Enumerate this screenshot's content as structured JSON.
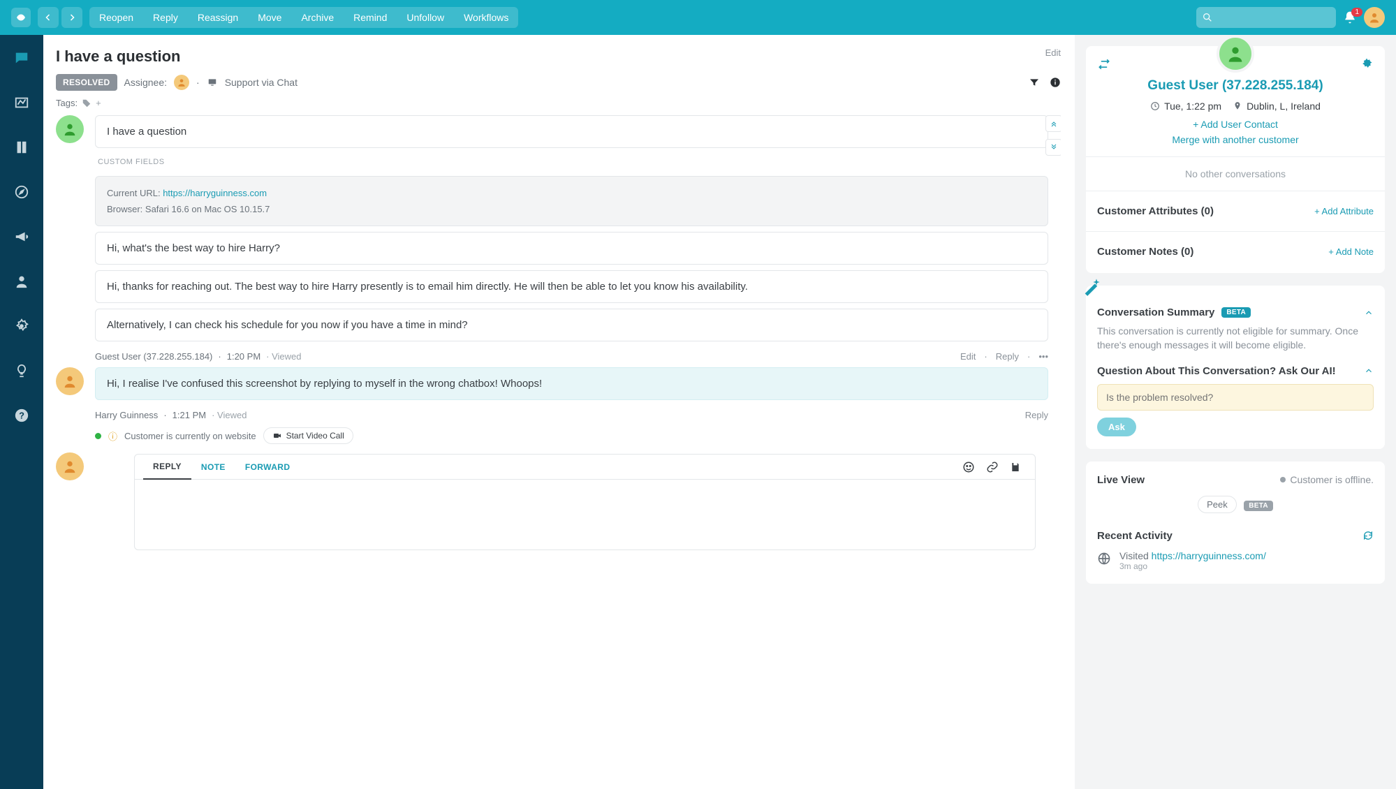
{
  "topbar": {
    "actions": [
      "Reopen",
      "Reply",
      "Reassign",
      "Move",
      "Archive",
      "Remind",
      "Unfollow",
      "Workflows"
    ],
    "notification_count": "1"
  },
  "conv": {
    "title": "I have a question",
    "edit": "Edit",
    "resolved": "RESOLVED",
    "assignee_lbl": "Assignee:",
    "support_via": "Support via Chat",
    "tags_lbl": "Tags:",
    "first_bubble": "I have a question",
    "custom_fields_lbl": "CUSTOM FIELDS",
    "cf_url_lbl": "Current URL: ",
    "cf_url": "https://harryguinness.com",
    "cf_browser": "Browser: Safari 16.6 on Mac OS 10.15.7",
    "m2": "Hi, what's the best way to hire Harry?",
    "m3": "Hi, thanks for reaching out. The best way to hire Harry presently is to email him directly. He will then be able to let you know his availability.",
    "m4": "Alternatively, I can check his schedule for you now if you have a time in mind?",
    "meta1_name": "Guest User (37.228.255.184)",
    "meta1_time": "1:20 PM",
    "meta1_viewed": "Viewed",
    "meta1_edit": "Edit",
    "meta1_reply": "Reply",
    "m5": "Hi, I realise I've confused this screenshot by replying to myself in the wrong chatbox! Whoops!",
    "meta2_name": "Harry Guinness",
    "meta2_time": "1:21 PM",
    "meta2_viewed": "Viewed",
    "meta2_reply": "Reply",
    "online_status": "Customer is currently on website",
    "start_video": "Start Video Call",
    "tabs": {
      "reply": "REPLY",
      "note": "NOTE",
      "forward": "FORWARD"
    }
  },
  "customer": {
    "name": "Guest User (37.228.255.184)",
    "time": "Tue, 1:22 pm",
    "location": "Dublin, L, Ireland",
    "add_contact": "+ Add User Contact",
    "merge": "Merge with another customer",
    "no_conv": "No other conversations",
    "attr_lbl": "Customer Attributes (0)",
    "attr_add": "+ Add Attribute",
    "notes_lbl": "Customer Notes (0)",
    "notes_add": "+ Add Note"
  },
  "summary": {
    "title": "Conversation Summary",
    "beta": "BETA",
    "body": "This conversation is currently not eligible for summary. Once there's enough messages it will become eligible.",
    "ai_title": "Question About This Conversation? Ask Our AI!",
    "ai_placeholder": "Is the problem resolved?",
    "ask": "Ask"
  },
  "live": {
    "title": "Live View",
    "status": "Customer is offline.",
    "peek": "Peek",
    "beta": "BETA"
  },
  "recent": {
    "title": "Recent Activity",
    "visited_lbl": "Visited ",
    "visited_url": "https://harryguinness.com/",
    "time": "3m ago"
  }
}
